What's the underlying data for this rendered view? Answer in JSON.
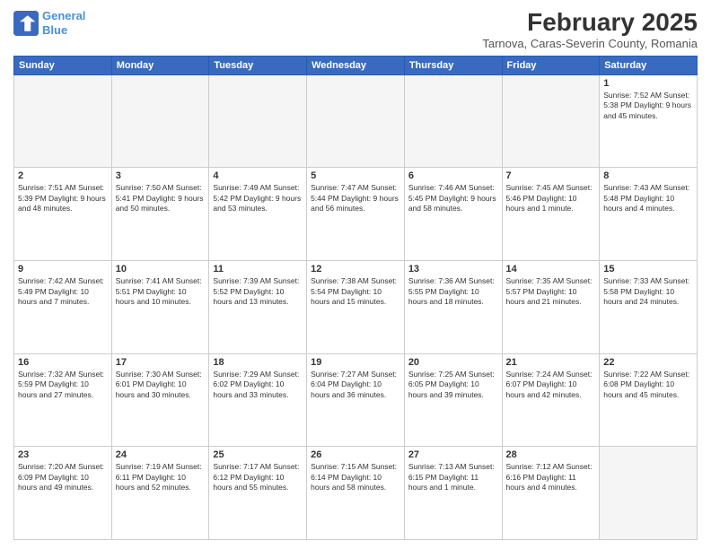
{
  "header": {
    "logo_line1": "General",
    "logo_line2": "Blue",
    "main_title": "February 2025",
    "subtitle": "Tarnova, Caras-Severin County, Romania"
  },
  "weekdays": [
    "Sunday",
    "Monday",
    "Tuesday",
    "Wednesday",
    "Thursday",
    "Friday",
    "Saturday"
  ],
  "weeks": [
    [
      {
        "day": "",
        "info": ""
      },
      {
        "day": "",
        "info": ""
      },
      {
        "day": "",
        "info": ""
      },
      {
        "day": "",
        "info": ""
      },
      {
        "day": "",
        "info": ""
      },
      {
        "day": "",
        "info": ""
      },
      {
        "day": "1",
        "info": "Sunrise: 7:52 AM\nSunset: 5:38 PM\nDaylight: 9 hours and 45 minutes."
      }
    ],
    [
      {
        "day": "2",
        "info": "Sunrise: 7:51 AM\nSunset: 5:39 PM\nDaylight: 9 hours and 48 minutes."
      },
      {
        "day": "3",
        "info": "Sunrise: 7:50 AM\nSunset: 5:41 PM\nDaylight: 9 hours and 50 minutes."
      },
      {
        "day": "4",
        "info": "Sunrise: 7:49 AM\nSunset: 5:42 PM\nDaylight: 9 hours and 53 minutes."
      },
      {
        "day": "5",
        "info": "Sunrise: 7:47 AM\nSunset: 5:44 PM\nDaylight: 9 hours and 56 minutes."
      },
      {
        "day": "6",
        "info": "Sunrise: 7:46 AM\nSunset: 5:45 PM\nDaylight: 9 hours and 58 minutes."
      },
      {
        "day": "7",
        "info": "Sunrise: 7:45 AM\nSunset: 5:46 PM\nDaylight: 10 hours and 1 minute."
      },
      {
        "day": "8",
        "info": "Sunrise: 7:43 AM\nSunset: 5:48 PM\nDaylight: 10 hours and 4 minutes."
      }
    ],
    [
      {
        "day": "9",
        "info": "Sunrise: 7:42 AM\nSunset: 5:49 PM\nDaylight: 10 hours and 7 minutes."
      },
      {
        "day": "10",
        "info": "Sunrise: 7:41 AM\nSunset: 5:51 PM\nDaylight: 10 hours and 10 minutes."
      },
      {
        "day": "11",
        "info": "Sunrise: 7:39 AM\nSunset: 5:52 PM\nDaylight: 10 hours and 13 minutes."
      },
      {
        "day": "12",
        "info": "Sunrise: 7:38 AM\nSunset: 5:54 PM\nDaylight: 10 hours and 15 minutes."
      },
      {
        "day": "13",
        "info": "Sunrise: 7:36 AM\nSunset: 5:55 PM\nDaylight: 10 hours and 18 minutes."
      },
      {
        "day": "14",
        "info": "Sunrise: 7:35 AM\nSunset: 5:57 PM\nDaylight: 10 hours and 21 minutes."
      },
      {
        "day": "15",
        "info": "Sunrise: 7:33 AM\nSunset: 5:58 PM\nDaylight: 10 hours and 24 minutes."
      }
    ],
    [
      {
        "day": "16",
        "info": "Sunrise: 7:32 AM\nSunset: 5:59 PM\nDaylight: 10 hours and 27 minutes."
      },
      {
        "day": "17",
        "info": "Sunrise: 7:30 AM\nSunset: 6:01 PM\nDaylight: 10 hours and 30 minutes."
      },
      {
        "day": "18",
        "info": "Sunrise: 7:29 AM\nSunset: 6:02 PM\nDaylight: 10 hours and 33 minutes."
      },
      {
        "day": "19",
        "info": "Sunrise: 7:27 AM\nSunset: 6:04 PM\nDaylight: 10 hours and 36 minutes."
      },
      {
        "day": "20",
        "info": "Sunrise: 7:25 AM\nSunset: 6:05 PM\nDaylight: 10 hours and 39 minutes."
      },
      {
        "day": "21",
        "info": "Sunrise: 7:24 AM\nSunset: 6:07 PM\nDaylight: 10 hours and 42 minutes."
      },
      {
        "day": "22",
        "info": "Sunrise: 7:22 AM\nSunset: 6:08 PM\nDaylight: 10 hours and 45 minutes."
      }
    ],
    [
      {
        "day": "23",
        "info": "Sunrise: 7:20 AM\nSunset: 6:09 PM\nDaylight: 10 hours and 49 minutes."
      },
      {
        "day": "24",
        "info": "Sunrise: 7:19 AM\nSunset: 6:11 PM\nDaylight: 10 hours and 52 minutes."
      },
      {
        "day": "25",
        "info": "Sunrise: 7:17 AM\nSunset: 6:12 PM\nDaylight: 10 hours and 55 minutes."
      },
      {
        "day": "26",
        "info": "Sunrise: 7:15 AM\nSunset: 6:14 PM\nDaylight: 10 hours and 58 minutes."
      },
      {
        "day": "27",
        "info": "Sunrise: 7:13 AM\nSunset: 6:15 PM\nDaylight: 11 hours and 1 minute."
      },
      {
        "day": "28",
        "info": "Sunrise: 7:12 AM\nSunset: 6:16 PM\nDaylight: 11 hours and 4 minutes."
      },
      {
        "day": "",
        "info": ""
      }
    ]
  ]
}
